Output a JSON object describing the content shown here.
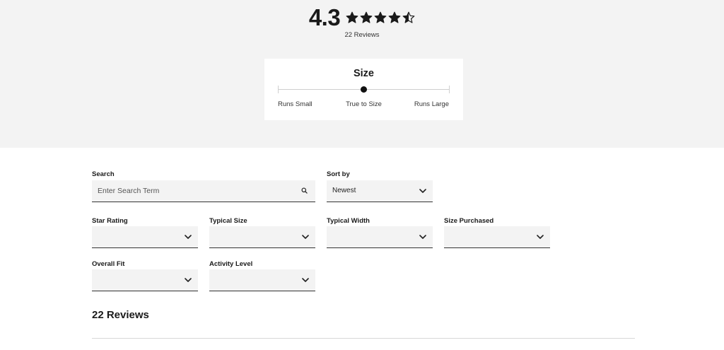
{
  "summary": {
    "rating": "4.3",
    "rating_value": 4.3,
    "stars_out_of": 5,
    "review_count_text": "22 Reviews"
  },
  "size_fit": {
    "title": "Size",
    "labels": {
      "small": "Runs Small",
      "true": "True to Size",
      "large": "Runs Large"
    },
    "value_fraction": 0.5
  },
  "filters": {
    "search": {
      "label": "Search",
      "placeholder": "Enter Search Term"
    },
    "sort": {
      "label": "Sort by",
      "value": "Newest"
    },
    "star_rating": {
      "label": "Star Rating",
      "value": ""
    },
    "typical_size": {
      "label": "Typical Size",
      "value": ""
    },
    "typical_width": {
      "label": "Typical Width",
      "value": ""
    },
    "size_purchased": {
      "label": "Size Purchased",
      "value": ""
    },
    "overall_fit": {
      "label": "Overall Fit",
      "value": ""
    },
    "activity_level": {
      "label": "Activity Level",
      "value": ""
    }
  },
  "reviews": {
    "heading": "22 Reviews"
  },
  "icons": {
    "star": "star-icon",
    "chevron": "chevron-down-icon",
    "search": "search-icon"
  },
  "colors": {
    "band": "#f3f3f3",
    "text": "#1a1a1a",
    "control": "#f3f3f3",
    "rule": "#333333"
  }
}
